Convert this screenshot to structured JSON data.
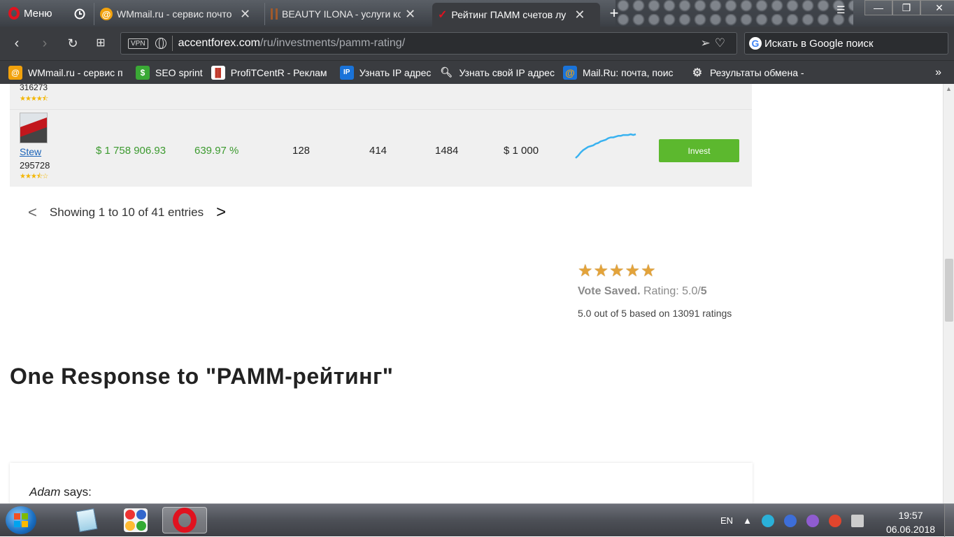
{
  "browser": {
    "menu_label": "Меню",
    "tabs": [
      {
        "title": "WMmail.ru - сервис почто",
        "icon": "wmmail-icon"
      },
      {
        "title": "BEAUTY ILONA - услуги ко",
        "icon": "beauty-icon"
      },
      {
        "title": "Рейтинг ПАММ счетов лу",
        "icon": "checkmark-icon",
        "active": true
      }
    ],
    "address": {
      "vpn_label": "VPN",
      "domain": "accentforex.com",
      "path": "/ru/investments/pamm-rating/"
    },
    "search_placeholder": "Искать в Google поиск",
    "bookmarks": [
      {
        "label": "WMmail.ru - сервис п",
        "icon": "wmmail-icon",
        "color": "#f2a20c"
      },
      {
        "label": "SEO sprint",
        "icon": "seosprint-icon",
        "color": "#3aa935"
      },
      {
        "label": "ProfiTCentR - Реклам",
        "icon": "profitcentr-icon",
        "color": "#e3a33a"
      },
      {
        "label": "Узнать IP адрес",
        "icon": "ip-icon",
        "color": "#1a73d9"
      },
      {
        "label": "Узнать свой IP адрес",
        "icon": "magnifier-icon",
        "color": "#cccccc"
      },
      {
        "label": "Mail.Ru: почта, поис",
        "icon": "mailru-icon",
        "color": "#f2a20c"
      },
      {
        "label": "Результаты обмена -",
        "icon": "exchange-icon",
        "color": "#dddddd"
      }
    ]
  },
  "table": {
    "partial_row": {
      "trader_id": "316273",
      "stars": "★★★★⯪"
    },
    "row": {
      "trader_name": "Stew",
      "trader_id": "295728",
      "stars": "★★★⯪☆",
      "balance": "$ 1 758 906.93",
      "gain": "639.97 %",
      "col3": "128",
      "col4": "414",
      "col5": "1484",
      "min_invest": "$ 1 000",
      "invest_label": "Invest",
      "equity_curve": [
        2,
        5,
        9,
        12,
        14,
        16,
        17,
        18,
        20,
        21,
        23,
        24,
        25,
        27,
        28,
        28,
        29,
        30,
        30,
        31,
        31,
        31,
        32,
        31,
        32
      ]
    }
  },
  "pagination": {
    "prev": "<",
    "text": "Showing 1 to 10 of 41 entries",
    "next": ">"
  },
  "rating": {
    "star_count": 5,
    "vote_saved": "Vote Saved.",
    "rating_label": "Rating: 5.0/",
    "rating_max": "5",
    "summary": "5.0 out of 5 based on 13091 ratings"
  },
  "responses": {
    "title": "One Response to \"PAMM-рейтинг\"",
    "comment_author": "Adam",
    "comment_says": " says:"
  },
  "taskbar": {
    "language": "EN",
    "time": "19:57",
    "date": "06.06.2018"
  },
  "colors": {
    "invest_button": "#5cb82e",
    "gain_text": "#3c9a2f",
    "equity_line": "#39b2f0",
    "star_gold": "#e3a33a"
  }
}
